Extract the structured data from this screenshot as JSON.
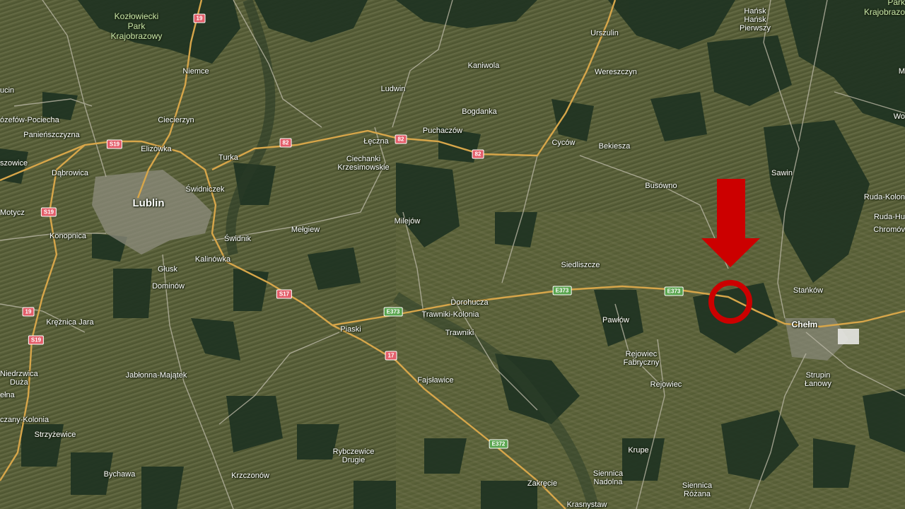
{
  "map": {
    "type": "satellite",
    "colors": {
      "base": "#4a5233",
      "field_light": "#6b6f44",
      "forest": "#1f3322",
      "road_major": "#d7a64a",
      "road_minor": "#b9b6a4",
      "marker": "#cc0000"
    },
    "places": [
      {
        "id": "lublin",
        "name": "Lublin",
        "size": "big"
      },
      {
        "id": "chelm",
        "name": "Chełm",
        "size": "mid"
      },
      {
        "id": "kozlowiecki",
        "name": "Kozłowiecki\nPark\nKrajobrazowy",
        "size": "park"
      },
      {
        "id": "krajobrazo",
        "name": "Park\nKrajobrazo",
        "size": "park"
      },
      {
        "id": "hansk",
        "name": "Hańsk\nHańsk\nPierwszy",
        "size": "small"
      },
      {
        "id": "urszulin",
        "name": "Urszulin",
        "size": "small"
      },
      {
        "id": "niemce",
        "name": "Niemce",
        "size": "small"
      },
      {
        "id": "kaniwola",
        "name": "Kaniwola",
        "size": "small"
      },
      {
        "id": "wereszczyn",
        "name": "Wereszczyn",
        "size": "small"
      },
      {
        "id": "ludwin",
        "name": "Ludwin",
        "size": "small"
      },
      {
        "id": "bogdanka",
        "name": "Bogdanka",
        "size": "small"
      },
      {
        "id": "ucin",
        "name": "ucin",
        "size": "small"
      },
      {
        "id": "jozefow",
        "name": "ózefów-Pociecha",
        "size": "small"
      },
      {
        "id": "ciecierzyn",
        "name": "Ciecierzyn",
        "size": "small"
      },
      {
        "id": "panienszczyzna",
        "name": "Panieńszczyzna",
        "size": "small"
      },
      {
        "id": "elizowka",
        "name": "Elizówka",
        "size": "small"
      },
      {
        "id": "leczna",
        "name": "Łęczna",
        "size": "small"
      },
      {
        "id": "puchaczow",
        "name": "Puchaczów",
        "size": "small"
      },
      {
        "id": "cycow",
        "name": "Cyców",
        "size": "small"
      },
      {
        "id": "bekiesza",
        "name": "Bekiesza",
        "size": "small"
      },
      {
        "id": "szowice",
        "name": "szowice",
        "size": "small"
      },
      {
        "id": "dabrowica",
        "name": "Dąbrowica",
        "size": "small"
      },
      {
        "id": "turka",
        "name": "Turka",
        "size": "small"
      },
      {
        "id": "ciechanki",
        "name": "Ciechanki\nKrzesimowskie",
        "size": "small"
      },
      {
        "id": "sawin",
        "name": "Sawin",
        "size": "small"
      },
      {
        "id": "swidniczek",
        "name": "Świdniczek",
        "size": "small"
      },
      {
        "id": "busowno",
        "name": "Busówno",
        "size": "small"
      },
      {
        "id": "ruda_kolonia",
        "name": "Ruda-Kolon",
        "size": "small"
      },
      {
        "id": "ruda_huta",
        "name": "Ruda-Hu",
        "size": "small"
      },
      {
        "id": "chromow",
        "name": "Chromóv",
        "size": "small"
      },
      {
        "id": "motycz",
        "name": "Motycz",
        "size": "small"
      },
      {
        "id": "konopnica",
        "name": "Konopnica",
        "size": "small"
      },
      {
        "id": "swidnik",
        "name": "Świdnik",
        "size": "small"
      },
      {
        "id": "melgiew",
        "name": "Mełgiew",
        "size": "small"
      },
      {
        "id": "milejow",
        "name": "Milejów",
        "size": "small"
      },
      {
        "id": "kalinowka",
        "name": "Kalinówka",
        "size": "small"
      },
      {
        "id": "glusk",
        "name": "Głusk",
        "size": "small"
      },
      {
        "id": "dominow",
        "name": "Dominów",
        "size": "small"
      },
      {
        "id": "siedliszcze",
        "name": "Siedliszcze",
        "size": "small"
      },
      {
        "id": "stankow",
        "name": "Stańków",
        "size": "small"
      },
      {
        "id": "dorohucza",
        "name": "Dorohucza",
        "size": "small"
      },
      {
        "id": "trawniki_kolonia",
        "name": "Trawniki-Kolonia",
        "size": "small"
      },
      {
        "id": "trawniki",
        "name": "Trawniki",
        "size": "small"
      },
      {
        "id": "pawlow",
        "name": "Pawłów",
        "size": "small"
      },
      {
        "id": "krznica",
        "name": "Krężnica Jara",
        "size": "small"
      },
      {
        "id": "piaski",
        "name": "Piaski",
        "size": "small"
      },
      {
        "id": "rejowiec_fabryczny",
        "name": "Rejowiec\nFabryczny",
        "size": "small"
      },
      {
        "id": "niedrzwica",
        "name": "Niedrzwica\nDuża",
        "size": "small"
      },
      {
        "id": "jablonna",
        "name": "Jabłonna-Majątek",
        "size": "small"
      },
      {
        "id": "fajslawice",
        "name": "Fajsławice",
        "size": "small"
      },
      {
        "id": "rejowiec",
        "name": "Rejowiec",
        "size": "small"
      },
      {
        "id": "strupin",
        "name": "Strupin\nŁanowy",
        "size": "small"
      },
      {
        "id": "elna",
        "name": "ełna",
        "size": "small"
      },
      {
        "id": "czany",
        "name": "czany-Kolonia",
        "size": "small"
      },
      {
        "id": "strzyzewice",
        "name": "Strzyżewice",
        "size": "small"
      },
      {
        "id": "krupe",
        "name": "Krupe",
        "size": "small"
      },
      {
        "id": "rybczewice",
        "name": "Rybczewice\nDrugie",
        "size": "small"
      },
      {
        "id": "siennica_nadolna",
        "name": "Siennica\nNadolna",
        "size": "small"
      },
      {
        "id": "bychawa",
        "name": "Bychawa",
        "size": "small"
      },
      {
        "id": "krzczonow",
        "name": "Krzczonów",
        "size": "small"
      },
      {
        "id": "siennica_rozana",
        "name": "Siennica\nRóżana",
        "size": "small"
      },
      {
        "id": "zakrecie",
        "name": "Zakręcie",
        "size": "small"
      },
      {
        "id": "krasnystaw",
        "name": "Krasnystaw",
        "size": "small"
      },
      {
        "id": "wola",
        "name": "Wo",
        "size": "small"
      },
      {
        "id": "m_edge",
        "name": "M",
        "size": "small"
      }
    ],
    "road_shields": [
      {
        "id": "r19_top",
        "label": "19",
        "color": "red"
      },
      {
        "id": "s19_a",
        "label": "S19",
        "color": "red"
      },
      {
        "id": "r82_a",
        "label": "82",
        "color": "red"
      },
      {
        "id": "r82_b",
        "label": "82",
        "color": "red"
      },
      {
        "id": "r82_c",
        "label": "82",
        "color": "red"
      },
      {
        "id": "s19_b",
        "label": "S19",
        "color": "red"
      },
      {
        "id": "s17",
        "label": "S17",
        "color": "red"
      },
      {
        "id": "e373_a",
        "label": "E373",
        "color": "green"
      },
      {
        "id": "e373_b",
        "label": "E373",
        "color": "green"
      },
      {
        "id": "e373_c",
        "label": "E373",
        "color": "green"
      },
      {
        "id": "r19_b",
        "label": "19",
        "color": "red"
      },
      {
        "id": "s19_c",
        "label": "S19",
        "color": "red"
      },
      {
        "id": "r17",
        "label": "17",
        "color": "red"
      },
      {
        "id": "e372",
        "label": "E372",
        "color": "green"
      }
    ],
    "annotation": {
      "arrow_icon": "down-arrow-icon",
      "circle_icon": "circle-marker-icon",
      "color": "#cc0000"
    }
  }
}
